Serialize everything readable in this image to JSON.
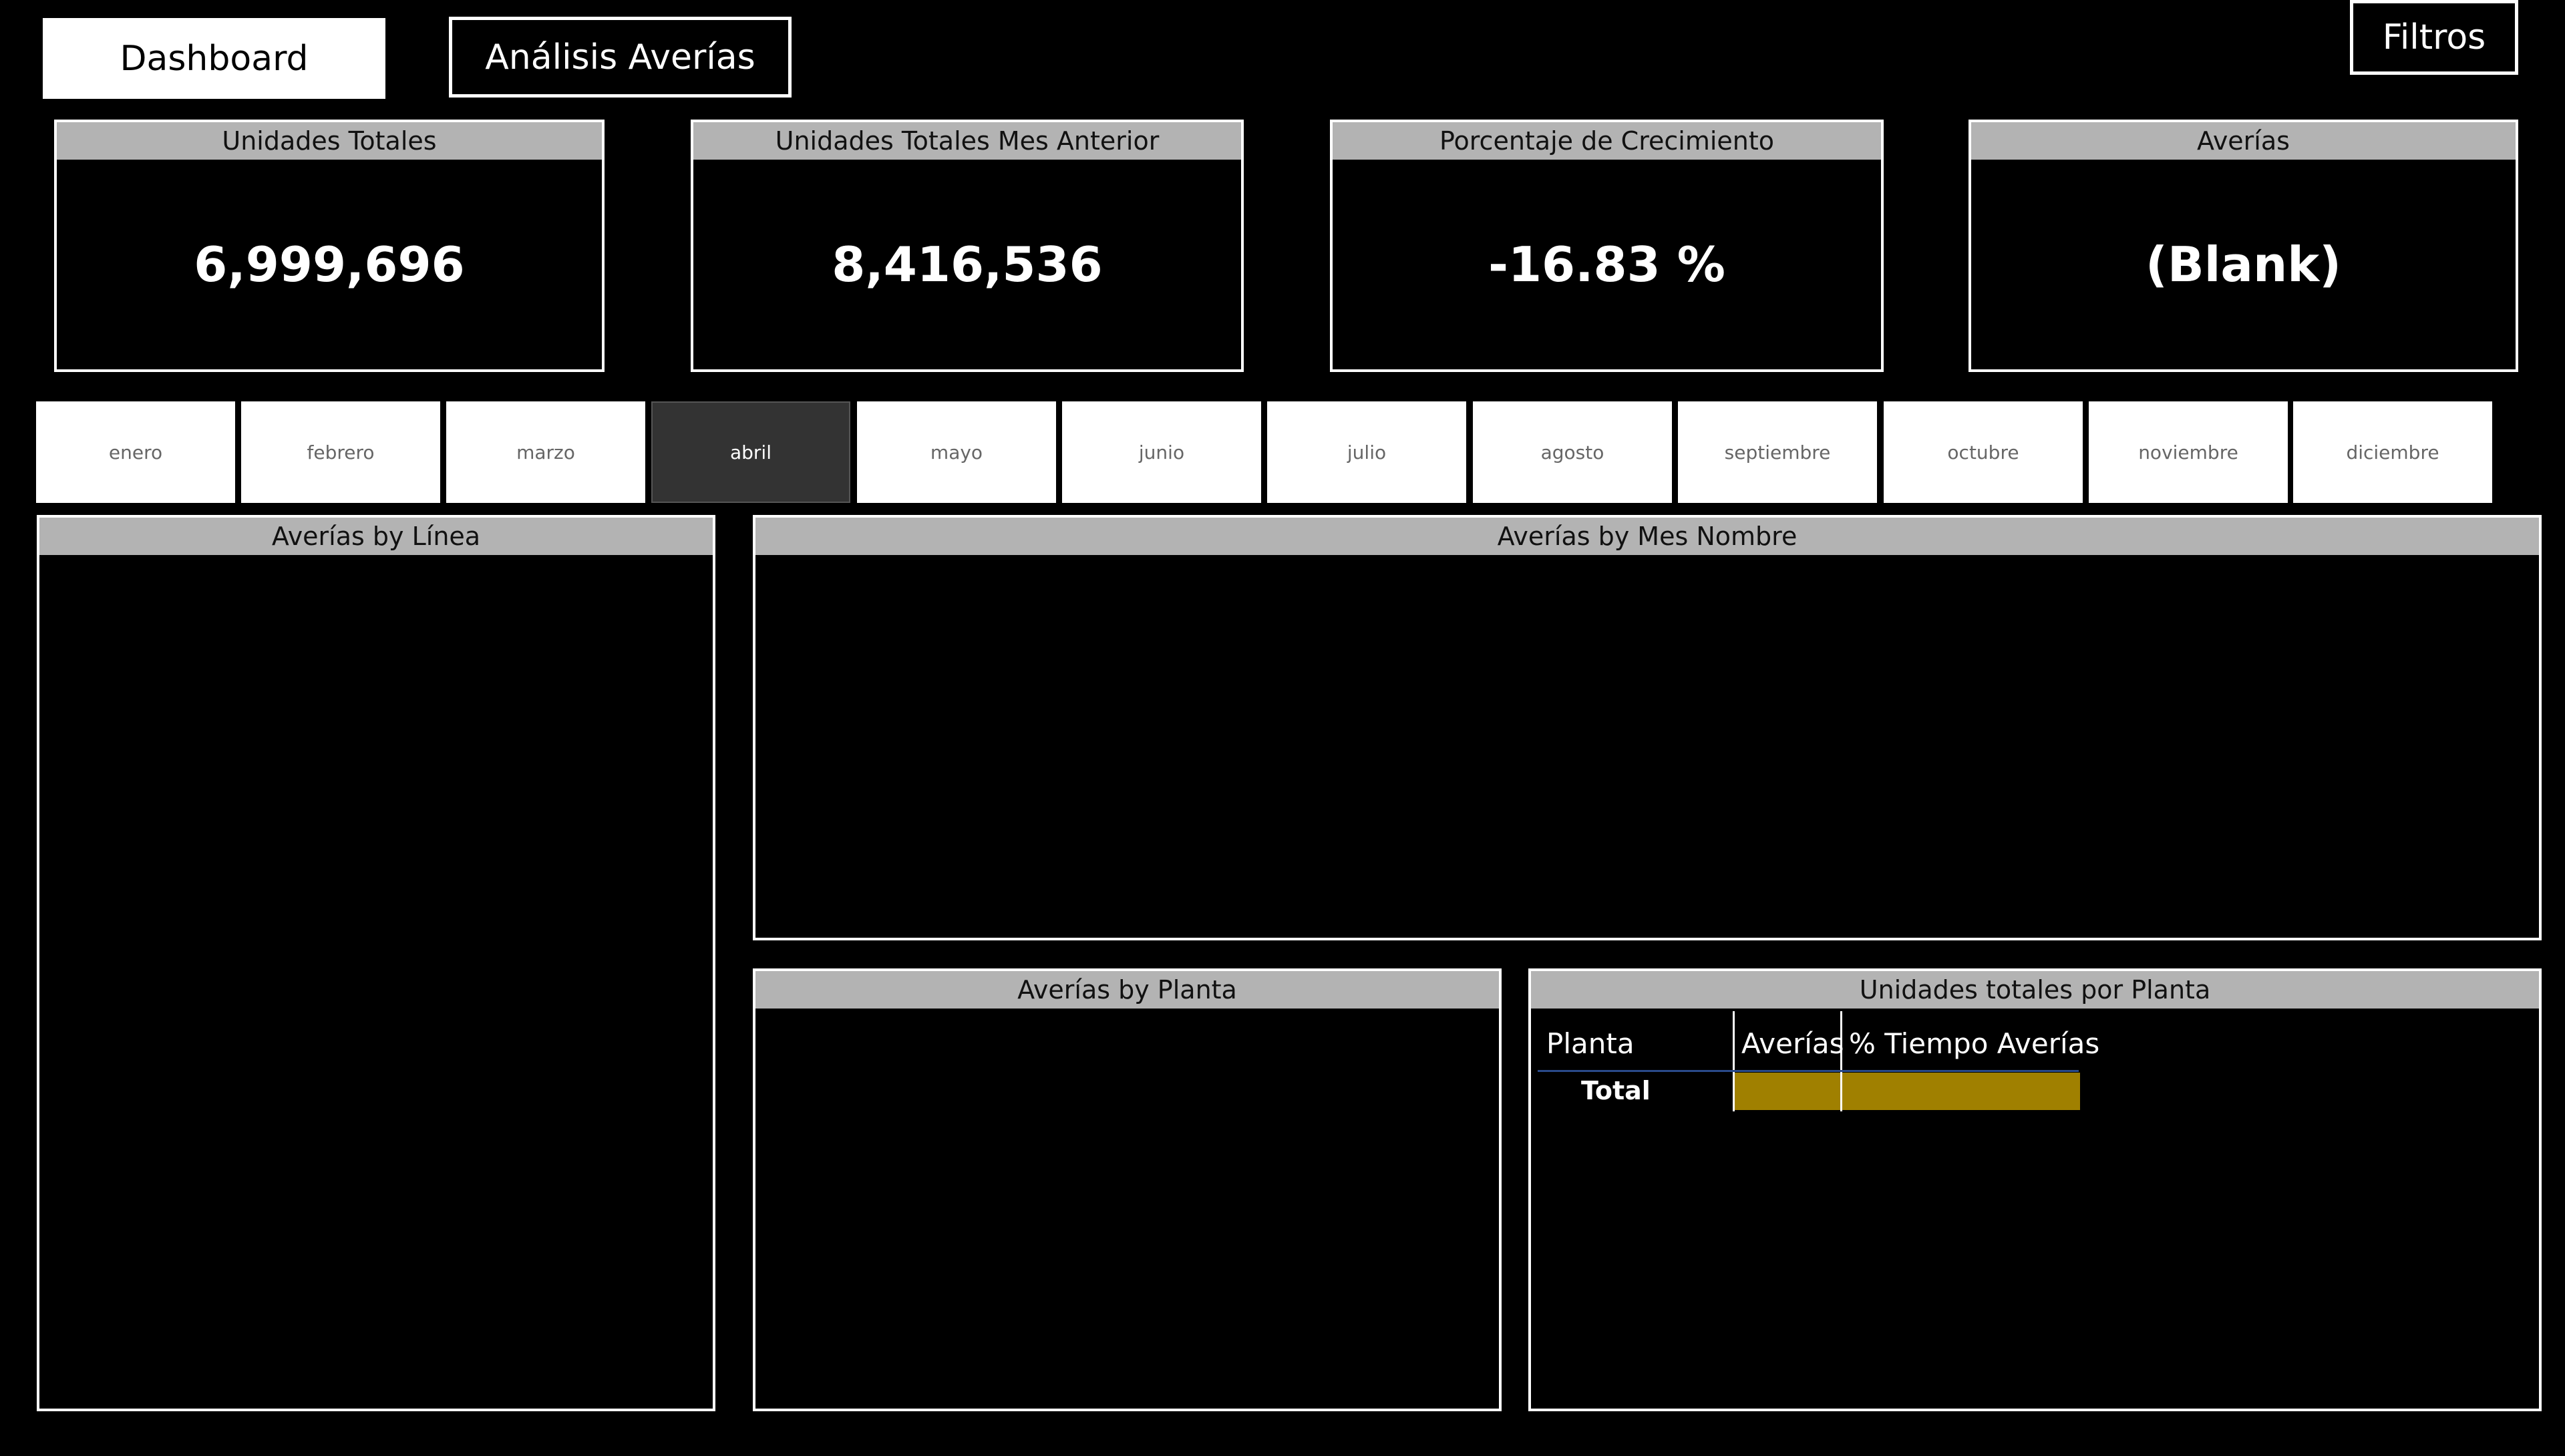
{
  "nav": {
    "dashboard_label": "Dashboard",
    "analisis_label": "Análisis Averías",
    "filtros_label": "Filtros"
  },
  "kpis": [
    {
      "title": "Unidades Totales",
      "value": "6,999,696"
    },
    {
      "title": "Unidades Totales Mes Anterior",
      "value": "8,416,536"
    },
    {
      "title": "Porcentaje de Crecimiento",
      "value": "-16.83 %"
    },
    {
      "title": "Averías",
      "value": "(Blank)"
    }
  ],
  "months": {
    "items": [
      "enero",
      "febrero",
      "marzo",
      "abril",
      "mayo",
      "junio",
      "julio",
      "agosto",
      "septiembre",
      "octubre",
      "noviembre",
      "diciembre"
    ],
    "selected": "abril"
  },
  "panels": {
    "by_linea_title": "Averías by Línea",
    "by_mes_title": "Averías by Mes Nombre",
    "by_planta_title": "Averías by Planta",
    "table_title": "Unidades totales por Planta"
  },
  "table": {
    "columns": [
      "Planta",
      "Averías",
      "% Tiempo Averías"
    ],
    "total_label": "Total",
    "total_fill_color": "#a08000"
  },
  "colors": {
    "background": "#000000",
    "header_gray": "#b3b3b3",
    "selected_month": "#333333",
    "total_bar": "#a08000",
    "table_rule": "#2a4a8a"
  }
}
